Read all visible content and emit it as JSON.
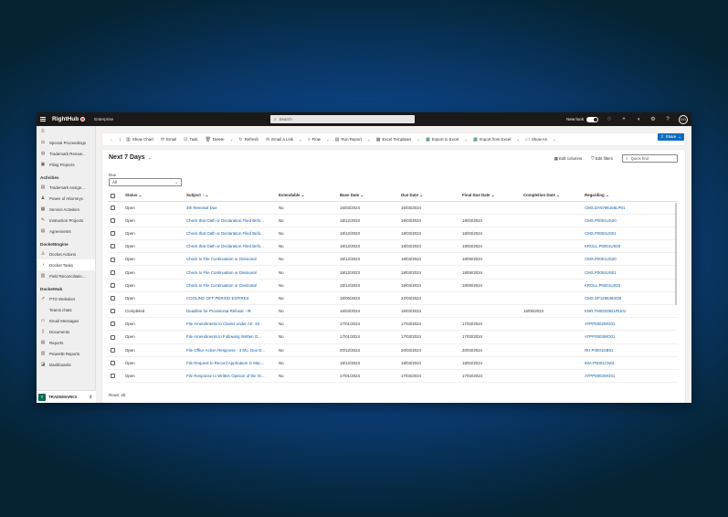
{
  "topbar": {
    "app_name": "RightHub",
    "environment": "Enterprise",
    "search_placeholder": "Search",
    "new_look_label": "New look",
    "user_initials": "GO"
  },
  "sidebar": {
    "items_top": [
      {
        "label": "Special Proceedings",
        "icon": "gavel-icon",
        "glyph": "⚖"
      },
      {
        "label": "Trademark Renew...",
        "icon": "globe-icon",
        "glyph": "◍"
      },
      {
        "label": "Filing Projects",
        "icon": "folder-icon",
        "glyph": "▣"
      }
    ],
    "groups": [
      {
        "title": "Activities",
        "items": [
          {
            "label": "Trademark Assign...",
            "glyph": "▤",
            "active": false
          },
          {
            "label": "Power of Attorneys",
            "glyph": "♟",
            "active": false
          },
          {
            "label": "Service Activities",
            "glyph": "▦",
            "active": false
          },
          {
            "label": "Instruction Projects",
            "glyph": "✎",
            "active": false
          },
          {
            "label": "Agreements",
            "glyph": "▤",
            "active": false
          }
        ]
      },
      {
        "title": "DocketEngine",
        "items": [
          {
            "label": "Docket Actions",
            "glyph": "♙",
            "active": false
          },
          {
            "label": "Docket Tasks",
            "glyph": "◔",
            "active": true
          },
          {
            "label": "Field Reconciliatio...",
            "glyph": "▧",
            "active": false
          }
        ]
      },
      {
        "title": "DocketHub",
        "items": [
          {
            "label": "PTO Websites",
            "glyph": "⇗",
            "active": false
          },
          {
            "label": "Teams chats",
            "glyph": "",
            "active": false
          },
          {
            "label": "Email Messages",
            "glyph": "▭",
            "active": false
          },
          {
            "label": "Documents",
            "glyph": "▯",
            "active": false
          },
          {
            "label": "Reports",
            "glyph": "▤",
            "active": false
          },
          {
            "label": "PowerBI Reports",
            "glyph": "▥",
            "active": false
          },
          {
            "label": "Dashboards",
            "glyph": "◪",
            "active": false
          }
        ]
      }
    ],
    "area": {
      "badge": "T",
      "label": "TRADEMARKS"
    }
  },
  "commandbar": {
    "items": [
      {
        "label": "Show Chart",
        "glyph": "▥",
        "icon": "chart-icon",
        "dd": false
      },
      {
        "label": "Email",
        "glyph": "✉",
        "icon": "mail-icon",
        "dd": false
      },
      {
        "label": "Task",
        "glyph": "☑",
        "icon": "task-icon",
        "dd": false
      },
      {
        "label": "Delete",
        "glyph": "🗑",
        "icon": "trash-icon",
        "dd": true
      },
      {
        "label": "Refresh",
        "glyph": "↻",
        "icon": "refresh-icon",
        "dd": false
      },
      {
        "label": "Email a Link",
        "glyph": "✉",
        "icon": "email-link-icon",
        "dd": true
      },
      {
        "label": "Flow",
        "glyph": "»",
        "icon": "flow-icon",
        "dd": true
      },
      {
        "label": "Run Report",
        "glyph": "▤",
        "icon": "report-icon",
        "dd": true
      },
      {
        "label": "Excel Templates",
        "glyph": "▦",
        "icon": "excel-template-icon",
        "dd": true
      },
      {
        "label": "Export to Excel",
        "glyph": "▦",
        "icon": "excel-export-icon",
        "dd": true,
        "green": true
      },
      {
        "label": "Import from Excel",
        "glyph": "▦",
        "icon": "excel-import-icon",
        "dd": true,
        "green": true
      },
      {
        "label": "Show As",
        "glyph": "▭",
        "icon": "show-as-icon",
        "dd": true
      }
    ],
    "share_label": "Share"
  },
  "view": {
    "title": "Next 7 Days",
    "edit_columns": "Edit columns",
    "edit_filters": "Edit filters",
    "quick_find_placeholder": "Quick find",
    "filter_label": "Due",
    "filter_value": "All",
    "rows_label": "Rows: 40"
  },
  "table": {
    "columns": [
      "Status",
      "Subject",
      "Extendable",
      "Base Date",
      "Due Date",
      "Final Due Date",
      "Completion Date",
      "Regarding"
    ],
    "rows": [
      [
        "Open",
        "4th Renewal Due",
        "No",
        "15/03/2024",
        "15/03/2024",
        "",
        "",
        "CMS.DA5786166LP01"
      ],
      [
        "Open",
        "Check that Oath or Declaration Filed Befo...",
        "No",
        "18/12/2023",
        "18/03/2024",
        "18/03/2024",
        "",
        "CMS.P0001US20"
      ],
      [
        "Open",
        "Check that Oath or Declaration Filed Befo...",
        "No",
        "18/12/2023",
        "18/03/2024",
        "18/03/2024",
        "",
        "CMS.P0004US01"
      ],
      [
        "Open",
        "Check that Oath or Declaration Filed Befo...",
        "No",
        "18/12/2023",
        "18/03/2024",
        "18/03/2024",
        "",
        "KROLL.P0001US03"
      ],
      [
        "Open",
        "Check to File Continuation or Divisional",
        "No",
        "18/12/2023",
        "18/03/2024",
        "18/06/2024",
        "",
        "CMS.P0001US20"
      ],
      [
        "Open",
        "Check to File Continuation or Divisional",
        "No",
        "18/12/2023",
        "18/03/2024",
        "18/06/2024",
        "",
        "CMS.P0004US01"
      ],
      [
        "Open",
        "Check to File Continuation or Divisional",
        "No",
        "18/12/2023",
        "18/03/2024",
        "18/06/2024",
        "",
        "KROLL.P0001US03"
      ],
      [
        "Open",
        "COOLING OFF PERIOD EXPIRES",
        "No",
        "15/06/2023",
        "22/03/2024",
        "",
        "",
        "CMS.SP1296484GB"
      ],
      [
        "Completed",
        "Deadline for Provisional Refusal - IR",
        "No",
        "16/03/2024",
        "16/03/2024",
        "",
        "16/06/2023",
        "KNR.TM0320821RU01"
      ],
      [
        "Open",
        "File Amendments to Claims under Art. 19",
        "No",
        "17/01/2024",
        "17/03/2024",
        "17/03/2024",
        "",
        "ATPP0002WO01"
      ],
      [
        "Open",
        "File Amendments to Following Written O...",
        "No",
        "17/01/2024",
        "17/03/2024",
        "17/03/2024",
        "",
        "ATPP0003WO01"
      ],
      [
        "Open",
        "File Office Action Response - 3 Mo. Due D...",
        "No",
        "20/12/2023",
        "20/03/2024",
        "20/03/2024",
        "",
        "RH.P0001GB01"
      ],
      [
        "Open",
        "File Request to Record Application in Mac...",
        "No",
        "18/12/2023",
        "18/03/2024",
        "18/03/2024",
        "",
        "IMA.P0001CN01"
      ],
      [
        "Open",
        "File Response to Written Opinion of the IS...",
        "No",
        "17/01/2024",
        "17/03/2024",
        "17/03/2024",
        "",
        "ATPP0002WO01"
      ]
    ]
  },
  "colors": {
    "accent": "#0f6cbd",
    "link": "#115ea3",
    "topbar": "#1b1a19",
    "excel": "#107c41"
  }
}
